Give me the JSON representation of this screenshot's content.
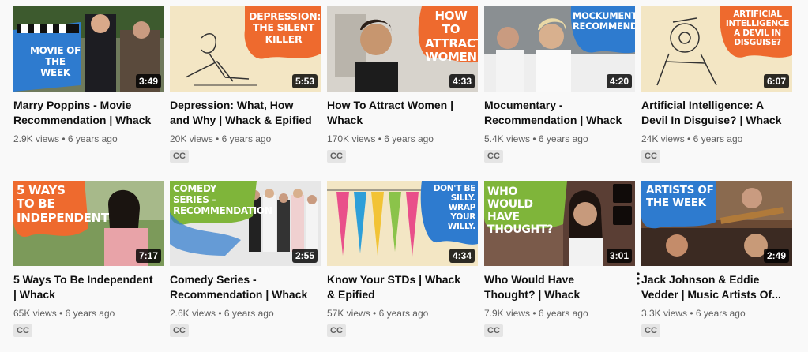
{
  "videos": [
    {
      "title": "Marry Poppins - Movie Recommendation | Whack",
      "views": "2.9K views",
      "age": "6 years ago",
      "duration": "3:49",
      "banner": "MOVIE OF THE WEEK",
      "cc": ""
    },
    {
      "title": "Depression: What, How and Why | Whack & Epified",
      "views": "20K views",
      "age": "6 years ago",
      "duration": "5:53",
      "banner": "DEPRESSION: THE SILENT KILLER",
      "cc": "CC"
    },
    {
      "title": "How To Attract Women | Whack",
      "views": "170K views",
      "age": "6 years ago",
      "duration": "4:33",
      "banner": "HOW TO ATTRACT WOMEN",
      "cc": "CC"
    },
    {
      "title": "Mocumentary - Recommendation | Whack",
      "views": "5.4K views",
      "age": "6 years ago",
      "duration": "4:20",
      "banner": "MOCKUMENTARY RECOMMENDATION",
      "cc": "CC"
    },
    {
      "title": "Artificial Intelligence: A Devil In Disguise? | Whack ...",
      "views": "24K views",
      "age": "6 years ago",
      "duration": "6:07",
      "banner": "ARTIFICIAL INTELLIGENCE A DEVIL IN DISGUISE?",
      "cc": "CC"
    },
    {
      "title": "5 Ways To Be Independent | Whack",
      "views": "65K views",
      "age": "6 years ago",
      "duration": "7:17",
      "banner": "5 WAYS TO BE INDEPENDENT",
      "cc": "CC"
    },
    {
      "title": "Comedy Series - Recommendation | Whack",
      "views": "2.6K views",
      "age": "6 years ago",
      "duration": "2:55",
      "banner": "COMEDY SERIES -RECOMMENDATION",
      "cc": "CC"
    },
    {
      "title": "Know Your STDs | Whack & Epified",
      "views": "57K views",
      "age": "6 years ago",
      "duration": "4:34",
      "banner": "DON'T BE SILLY. WRAP YOUR WILLY.",
      "cc": "CC"
    },
    {
      "title": "Who Would Have Thought? | Whack",
      "views": "7.9K views",
      "age": "6 years ago",
      "duration": "3:01",
      "banner": "WHO WOULD HAVE THOUGHT?",
      "cc": "CC"
    },
    {
      "title": "Jack Johnson & Eddie Vedder | Music Artists Of...",
      "views": "3.3K views",
      "age": "6 years ago",
      "duration": "2:49",
      "banner": "ARTISTS OF THE WEEK",
      "cc": "CC"
    }
  ],
  "meta_separator": "•",
  "icons": {
    "watch_later": "clock-icon",
    "add_to_queue": "queue-icon",
    "more": "more-vert-icon"
  }
}
